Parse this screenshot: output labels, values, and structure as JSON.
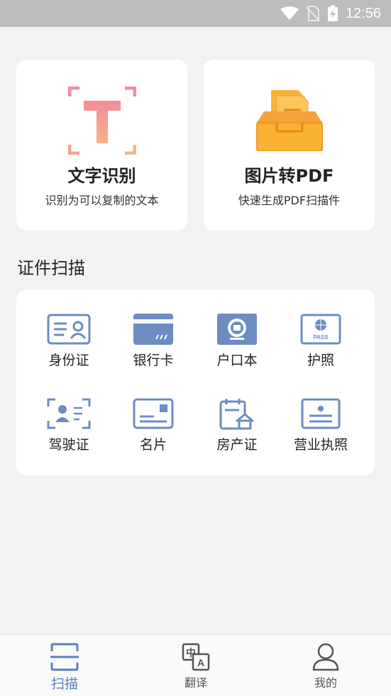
{
  "status_bar": {
    "time": "12:56"
  },
  "cards": {
    "ocr": {
      "title": "文字识别",
      "subtitle": "识别为可以复制的文本",
      "icon": "text-recognition-icon"
    },
    "pdf": {
      "title": "图片转PDF",
      "subtitle": "快速生成PDF扫描件",
      "icon": "inbox-documents-icon"
    }
  },
  "section": {
    "title": "证件扫描"
  },
  "documents": [
    {
      "label": "身份证",
      "icon": "id-card-icon"
    },
    {
      "label": "银行卡",
      "icon": "bank-card-icon"
    },
    {
      "label": "户口本",
      "icon": "household-register-icon"
    },
    {
      "label": "护照",
      "icon": "passport-icon"
    },
    {
      "label": "驾驶证",
      "icon": "driver-license-icon"
    },
    {
      "label": "名片",
      "icon": "business-card-icon"
    },
    {
      "label": "房产证",
      "icon": "property-certificate-icon"
    },
    {
      "label": "营业执照",
      "icon": "business-license-icon"
    }
  ],
  "passport_text": "PASS",
  "tabs": [
    {
      "label": "扫描",
      "icon": "scan-icon",
      "active": true
    },
    {
      "label": "翻译",
      "icon": "translate-icon",
      "active": false
    },
    {
      "label": "我的",
      "icon": "profile-icon",
      "active": false
    }
  ],
  "translate_glyphs": {
    "zh": "中",
    "en": "A"
  },
  "colors": {
    "accent_blue": "#5b7fc0",
    "icon_blue": "#6c8cc2",
    "orange": "#f7a23b",
    "pink": "#f59ea0",
    "status_bar": "#bdbdbd"
  }
}
